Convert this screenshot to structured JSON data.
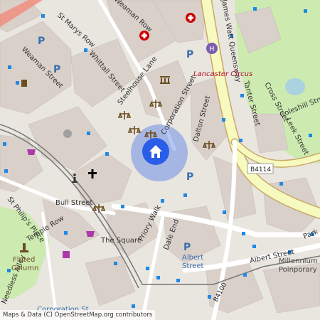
{
  "map": {
    "streets": {
      "st_marys_row": "St Marys Row",
      "weaman_row": "Weaman Row",
      "weaman_street": "Weaman Street",
      "whittall_street": "Whittall Street",
      "steelhouse_lane": "Steelhouse Lane",
      "corporation_street": "Corporation Street",
      "dalton_street": "Dalton Street",
      "james_watt_queensway": "James Watt Queensway",
      "lancaster_circus": "Lancaster Circus",
      "tanter_street": "Tanter Street",
      "cross_street": "Cross Street",
      "coleshill_street": "Coleshill Street",
      "leek_street": "Leek Street",
      "bull_street": "Bull Street",
      "st_philips_place": "St Philip's Place",
      "temple_row": "Temple Row",
      "priory_walk": "Priory Walk",
      "the_square": "The Square",
      "dale_end": "Dale End",
      "albert_street": "Albert Street",
      "albert_street_2": "Albert Street",
      "park_street": "Park",
      "needless_alley": "Needless Alley",
      "corporation_st_bottom": "Corporation St"
    },
    "road_refs": {
      "b4114": "B4114",
      "b4100": "B4100"
    },
    "places": {
      "fluted_column_1": "Fluted",
      "fluted_column_2": "Column",
      "millennium_1": "Millennium",
      "millennium_2": "Poinporary",
      "albert_street_stop_1": "Albert",
      "albert_street_stop_2": "Street"
    },
    "attribution": "Maps & Data (C) OpenStreetMap.org contributors",
    "colors": {
      "background": "#e9e5df",
      "building": "#d9d0c9",
      "park": "#cdebb0",
      "road_major": "#f7fabf",
      "road_trunk": "#f9d29c",
      "location": "#2a5ee8",
      "transit_stop": "#1e88e5"
    },
    "icons": {
      "location_marker": "home-location-icon",
      "hospital": "hospital-icon",
      "courthouse": "courthouse-icon",
      "parking": "parking-icon",
      "church": "church-icon",
      "info": "info-icon",
      "shop": "shop-icon",
      "monument": "monument-icon",
      "museum": "museum-icon"
    }
  }
}
